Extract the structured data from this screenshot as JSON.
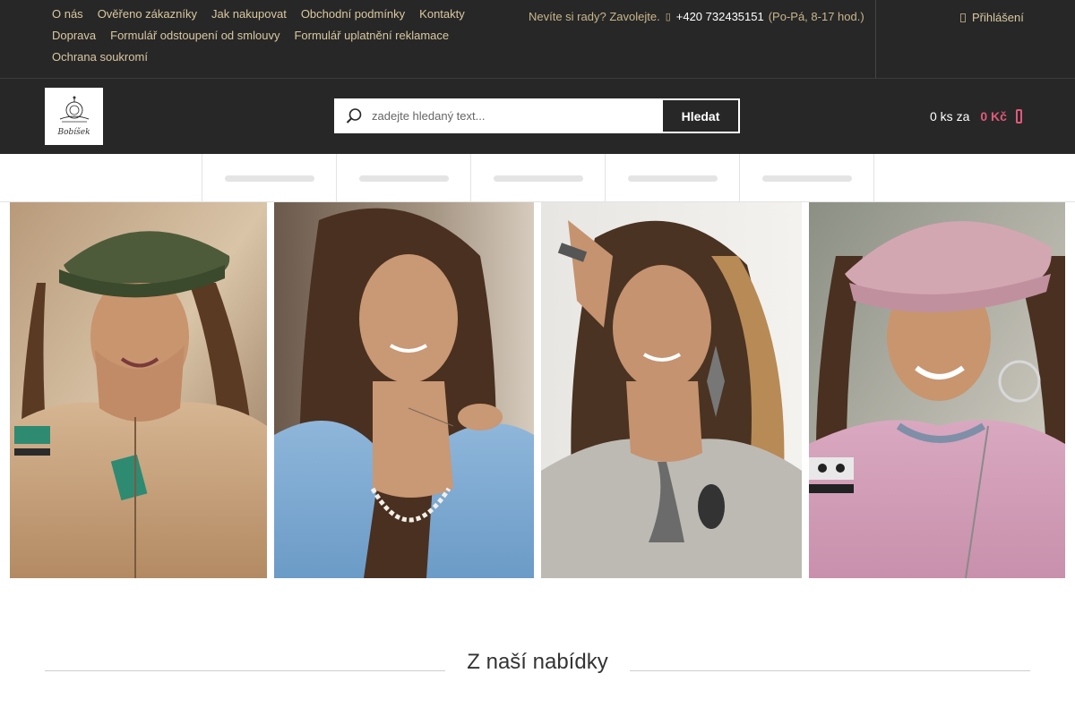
{
  "top_links": [
    "O nás",
    "Ověřeno zákazníky",
    "Jak nakupovat",
    "Obchodní podmínky",
    "Kontakty",
    "Doprava",
    "Formulář odstoupení od smlouvy",
    "Formulář uplatnění reklamace",
    "Ochrana soukromí"
  ],
  "contact": {
    "prompt": "Nevíte si rady? Zavolejte.",
    "phone": "+420 732435151",
    "hours": "(Po-Pá, 8-17 hod.)"
  },
  "login_label": "Přihlášení",
  "logo_text": "Bobíšek",
  "search": {
    "placeholder": "zadejte hledaný text...",
    "button_label": "Hledat"
  },
  "cart": {
    "count": "0 ks za",
    "price": "0 Kč"
  },
  "nav_items_count": 5,
  "banner_images": [
    "woman-green-cap-beige-jacket",
    "woman-blue-jacket-pearls",
    "woman-grey-sweater-brooch",
    "woman-pink-cap-pink-sweater"
  ],
  "section_title": "Z naší nabídky",
  "colors": {
    "header_bg": "#272727",
    "link_gold": "#d9c8a0",
    "accent_pink": "#e05a7a"
  }
}
